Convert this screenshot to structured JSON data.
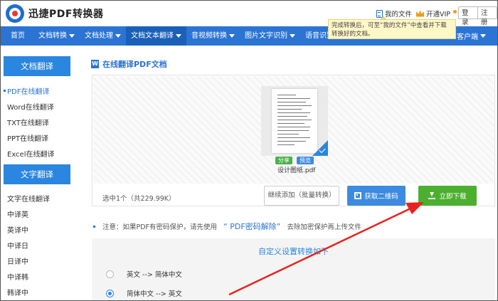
{
  "header": {
    "brand": "迅捷PDF转换器",
    "my_files": "我的文件",
    "vip": "开通VIP",
    "login": "登录",
    "register": "注册"
  },
  "nav": {
    "items": [
      "首页",
      "文档转换",
      "文档处理",
      "文档文本翻译",
      "音视频转换",
      "图片文字识别",
      "语音识别"
    ],
    "client": "客户端"
  },
  "tooltip": "完成转换后，可至“我的文件”中查看并下载转换好的文档。",
  "sidebar": {
    "group1": {
      "title": "文档翻译",
      "items": [
        "PDF在线翻译",
        "Word在线翻译",
        "TXT在线翻译",
        "PPT在线翻译",
        "Excel在线翻译"
      ]
    },
    "group2": {
      "title": "文字翻译",
      "items": [
        "文字在线翻译",
        "中译英",
        "英译中",
        "中译日",
        "日译中",
        "中译韩",
        "韩译中"
      ]
    }
  },
  "main": {
    "title": "在线翻译PDF文档",
    "file": {
      "name": "设计图纸.pdf",
      "share": "分享",
      "preview": "预览"
    },
    "selected_info": "选中1个（共229.99K）",
    "continue_add": "继续添加（批量转换）",
    "get_qr": "获取二维码",
    "download": "立即下载",
    "notice": {
      "prefix": "注意：如果PDF有密码保护，请先使用",
      "link": "“ PDF密码解除”",
      "suffix": "去除加密保护再上传文件"
    },
    "settings": {
      "title": "自定义设置转换如下",
      "options": [
        "英文 --> 简体中文",
        "简体中文 --> 英文"
      ],
      "selected": "简体中文 --> 英文"
    }
  },
  "colors": {
    "nav_blue": "#2b74d4",
    "download_green": "#4caf2f",
    "annotation_red": "#e8231e"
  }
}
